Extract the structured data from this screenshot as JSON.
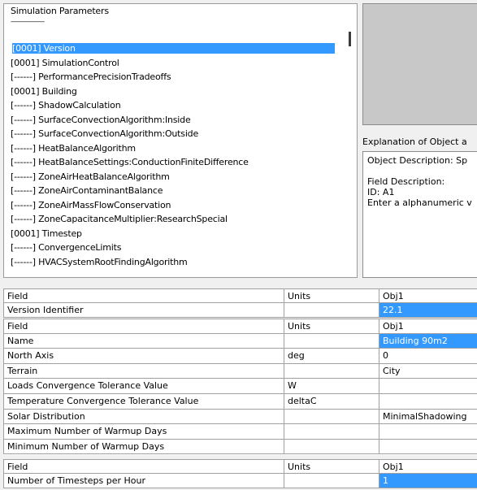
{
  "object_list": {
    "header": "Simulation Parameters",
    "separator": "---------------------------",
    "items": [
      {
        "label": "[0001]  Version",
        "selected": true
      },
      {
        "label": "[0001]  SimulationControl"
      },
      {
        "label": "[------]  PerformancePrecisionTradeoffs"
      },
      {
        "label": "[0001]  Building"
      },
      {
        "label": "[------]  ShadowCalculation"
      },
      {
        "label": "[------]  SurfaceConvectionAlgorithm:Inside"
      },
      {
        "label": "[------]  SurfaceConvectionAlgorithm:Outside"
      },
      {
        "label": "[------]  HeatBalanceAlgorithm"
      },
      {
        "label": "[------]  HeatBalanceSettings:ConductionFiniteDifference"
      },
      {
        "label": "[------]  ZoneAirHeatBalanceAlgorithm"
      },
      {
        "label": "[------]  ZoneAirContaminantBalance"
      },
      {
        "label": "[------]  ZoneAirMassFlowConservation"
      },
      {
        "label": "[------]  ZoneCapacitanceMultiplier:ResearchSpecial"
      },
      {
        "label": "[0001]  Timestep"
      },
      {
        "label": "[------]  ConvergenceLimits"
      },
      {
        "label": "[------]  HVACSystemRootFindingAlgorithm"
      }
    ]
  },
  "explanation": {
    "title": "Explanation of Object a",
    "lines": [
      "Object Description: Sp",
      "",
      "Field Description:",
      "ID: A1",
      "Enter a alphanumeric v"
    ]
  },
  "grid_version": {
    "headers": {
      "field": "Field",
      "units": "Units",
      "obj": "Obj1"
    },
    "rows": [
      {
        "field": "Version Identifier",
        "units": "",
        "value": "22.1",
        "selected": true
      }
    ]
  },
  "grid_building": {
    "headers": {
      "field": "Field",
      "units": "Units",
      "obj": "Obj1"
    },
    "rows": [
      {
        "field": "Name",
        "units": "",
        "value": "Building 90m2",
        "selected": true
      },
      {
        "field": "North Axis",
        "units": "deg",
        "value": "0"
      },
      {
        "field": "Terrain",
        "units": "",
        "value": "City"
      },
      {
        "field": "Loads Convergence Tolerance Value",
        "units": "W",
        "value": ""
      },
      {
        "field": "Temperature Convergence Tolerance Value",
        "units": "deltaC",
        "value": ""
      },
      {
        "field": "Solar Distribution",
        "units": "",
        "value": "MinimalShadowing"
      },
      {
        "field": "Maximum Number of Warmup Days",
        "units": "",
        "value": ""
      },
      {
        "field": "Minimum Number of Warmup Days",
        "units": "",
        "value": ""
      }
    ]
  },
  "grid_timestep": {
    "headers": {
      "field": "Field",
      "units": "Units",
      "obj": "Obj1"
    },
    "rows": [
      {
        "field": "Number of Timesteps per Hour",
        "units": "",
        "value": "1",
        "selected": true
      }
    ]
  },
  "colors": {
    "selection": "#3399ff",
    "preview_bg": "#c8c8c8"
  }
}
